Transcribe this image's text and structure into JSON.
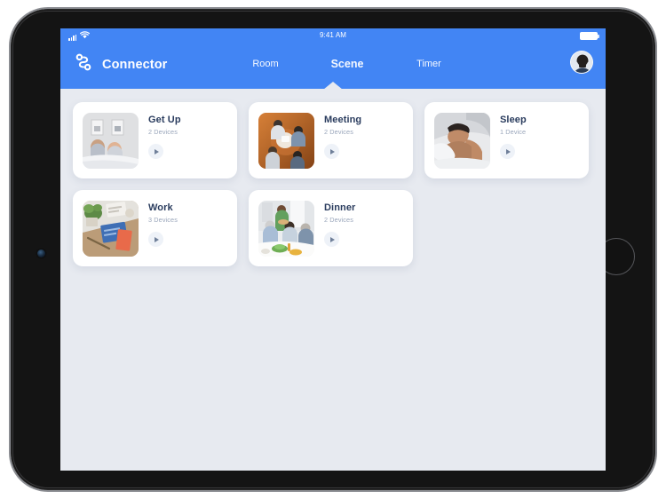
{
  "device": {
    "type": "tablet",
    "camera_icon": "front-camera-icon",
    "home_button_label": "Home"
  },
  "status_bar": {
    "signal_icon": "cellular-signal-icon",
    "wifi_icon": "wifi-icon",
    "time": "9:41 AM",
    "battery_icon": "battery-icon"
  },
  "header": {
    "logo_icon": "connector-logo-icon",
    "brand_title": "Connector",
    "avatar_icon": "user-avatar",
    "accent_color": "#4285F4",
    "tabs": [
      {
        "label": "Room",
        "active": false
      },
      {
        "label": "Scene",
        "active": true
      },
      {
        "label": "Timer",
        "active": false
      }
    ]
  },
  "main": {
    "background_color": "#E7EAF0",
    "scenes": [
      {
        "title": "Get Up",
        "devices": "2 Devices",
        "play_icon": "play-icon",
        "thumb": "bedroom-wakeup-photo"
      },
      {
        "title": "Meeting",
        "devices": "2 Devices",
        "play_icon": "play-icon",
        "thumb": "meeting-table-photo"
      },
      {
        "title": "Sleep",
        "devices": "1 Device",
        "play_icon": "play-icon",
        "thumb": "sleeping-person-photo"
      },
      {
        "title": "Work",
        "devices": "3 Devices",
        "play_icon": "play-icon",
        "thumb": "desk-workspace-photo"
      },
      {
        "title": "Dinner",
        "devices": "2 Devices",
        "play_icon": "play-icon",
        "thumb": "family-dinner-photo"
      }
    ]
  }
}
